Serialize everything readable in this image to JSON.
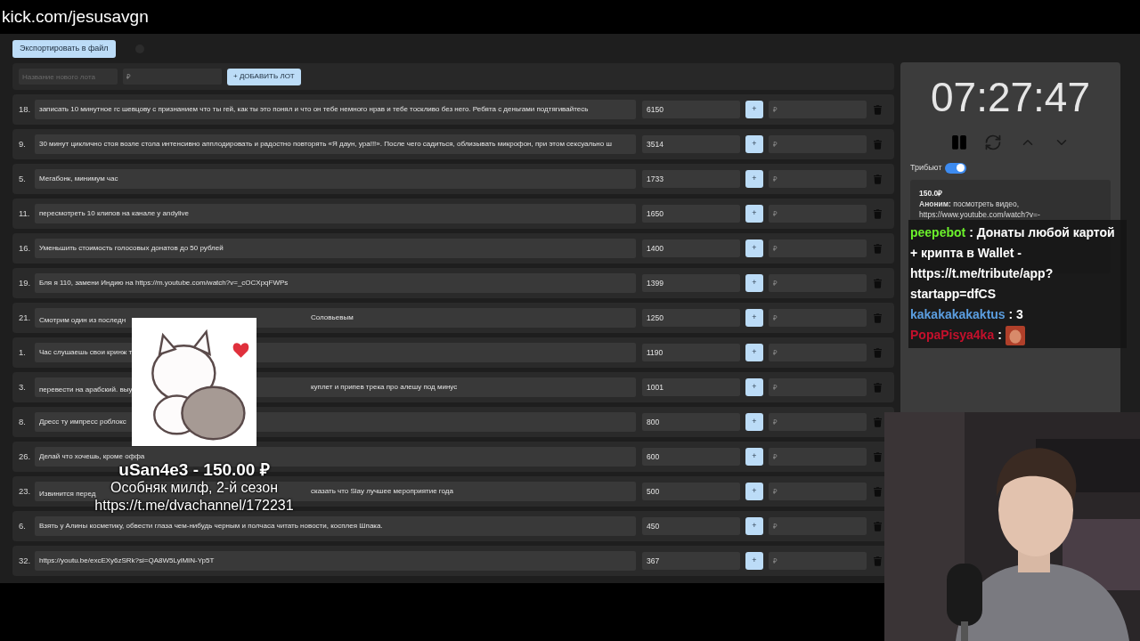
{
  "stream_url": "kick.com/jesusavgn",
  "toolbar": {
    "export_button": "Экспортировать в файл"
  },
  "new_lot": {
    "name_placeholder": "Название нового лота",
    "price_placeholder": "₽",
    "add_button": "+ ДОБАВИТЬ ЛОТ"
  },
  "lots": [
    {
      "number": "18.",
      "text_parts": [
        "записать 10 минутное гс шевцову с признанием что ты гей, как ты это понял и что он тебе немного нрав и тебе тоскливо без него. Ребята с деньгами подтягивайтесь"
      ],
      "amount": "6150",
      "plus": "+",
      "price_placeholder": "₽"
    },
    {
      "number": "9.",
      "text_parts": [
        "30 минут циклично стоя возле стола интенсивно апплодировать и радостно повторять «Я даун, ура!!!». После чего садиться, облизывать микрофон, при этом сексуально ш"
      ],
      "amount": "3514",
      "plus": "+",
      "price_placeholder": "₽"
    },
    {
      "number": "5.",
      "text_parts": [
        "Мегабонк, минимум час"
      ],
      "amount": "1733",
      "plus": "+",
      "price_placeholder": "₽"
    },
    {
      "number": "11.",
      "text_parts": [
        "пересмотреть 10 клипов на канале у andylive"
      ],
      "amount": "1650",
      "plus": "+",
      "price_placeholder": "₽"
    },
    {
      "number": "16.",
      "text_parts": [
        "Уменьшить стоимость голосовых донатов до 50 рублей"
      ],
      "amount": "1400",
      "plus": "+",
      "price_placeholder": "₽"
    },
    {
      "number": "19.",
      "text_parts": [
        "Бля я 110, замени Индию на https://m.youtube.com/watch?v=_cOCXpqFWPs"
      ],
      "amount": "1399",
      "plus": "+",
      "price_placeholder": "₽"
    },
    {
      "number": "21.",
      "text_parts": [
        "Смотрим один из последн",
        "Соловьевым"
      ],
      "amount": "1250",
      "plus": "+",
      "price_placeholder": "₽"
    },
    {
      "number": "1.",
      "text_parts": [
        "Час слушаешь свои кринж т"
      ],
      "amount": "1190",
      "plus": "+",
      "price_placeholder": "₽"
    },
    {
      "number": "3.",
      "text_parts": [
        "перевести на арабский. выу",
        "куплет и припев трека про алешу под минус"
      ],
      "amount": "1001",
      "plus": "+",
      "price_placeholder": "₽"
    },
    {
      "number": "8.",
      "text_parts": [
        "Дресс ту импресс роблокс"
      ],
      "amount": "800",
      "plus": "+",
      "price_placeholder": "₽"
    },
    {
      "number": "26.",
      "text_parts": [
        "Делай что хочешь, кроме оффа"
      ],
      "amount": "600",
      "plus": "+",
      "price_placeholder": "₽"
    },
    {
      "number": "23.",
      "text_parts": [
        "Извинится перед",
        "сказать что Slay лучшее мероприятие года"
      ],
      "amount": "500",
      "plus": "+",
      "price_placeholder": "₽"
    },
    {
      "number": "6.",
      "text_parts": [
        "Взять у Алины косметику, обвести глаза чем-нибудь черным и полчаса читать новости, косплея Шпака."
      ],
      "amount": "450",
      "plus": "+",
      "price_placeholder": "₽"
    },
    {
      "number": "32.",
      "text_parts": [
        "https://youtu.be/excEXy6zSRk?si=QA8W5LylMIN-Yp5T"
      ],
      "amount": "367",
      "plus": "+",
      "price_placeholder": "₽"
    }
  ],
  "timer": {
    "time": "07:27:47"
  },
  "tribute": {
    "label": "Трибьют",
    "on": true
  },
  "donation": {
    "amount": "150.0₽",
    "message": "**Аноним:** посмотреть видео, https://www.youtube.com/watch?v=-"
  },
  "chat": [
    {
      "kind": "text",
      "user": "peepebot",
      "color": "#6cf02c",
      "text": ": Донаты любой картой + крипта в Wallet - https://t.me/tribute/app?startapp=dfCS"
    },
    {
      "kind": "text",
      "user": "kakakakakaktus",
      "color": "#5b9ee0",
      "text": ": 3"
    },
    {
      "kind": "emote",
      "user": "PopaPisya4ka",
      "color": "#c4102c",
      "text": ":"
    }
  ],
  "alert": {
    "title": "uSan4e3 - 150.00 ₽",
    "message": "Особняк милф, 2-й сезон",
    "link": "https://t.me/dvachannel/172231"
  }
}
